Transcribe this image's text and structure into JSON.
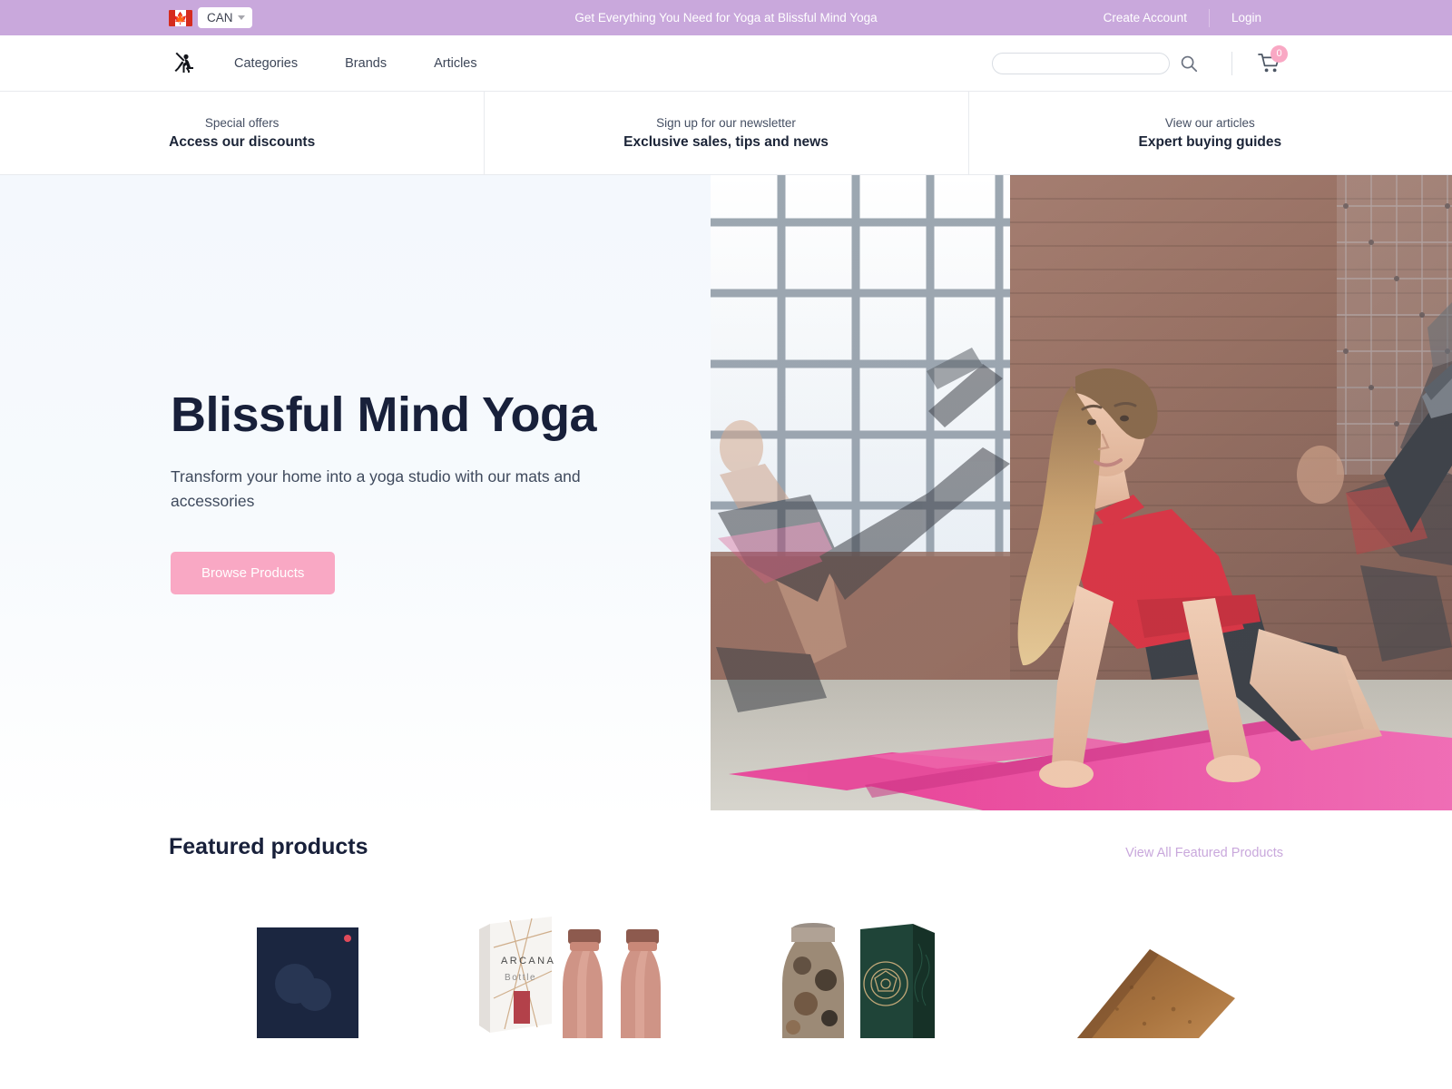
{
  "topbar": {
    "locale": {
      "country_code": "CAN",
      "flag": "canada-flag",
      "chevron": "chevron-down-icon"
    },
    "announcement": "Get Everything You Need for Yoga at Blissful Mind Yoga",
    "create_account": "Create Account",
    "login": "Login"
  },
  "header": {
    "logo_alt": "yoga-warrior-logo",
    "nav": [
      {
        "label": "Categories"
      },
      {
        "label": "Brands"
      },
      {
        "label": "Articles"
      }
    ],
    "search": {
      "value": "",
      "placeholder": ""
    },
    "search_icon": "search-icon",
    "cart": {
      "icon": "cart-icon",
      "count": "0"
    }
  },
  "promos": [
    {
      "small": "Special offers",
      "big": "Access our discounts"
    },
    {
      "small": "Sign up for our newsletter",
      "big": "Exclusive sales, tips and news"
    },
    {
      "small": "View our articles",
      "big": "Expert buying guides"
    }
  ],
  "hero": {
    "title": "Blissful Mind Yoga",
    "subtitle": "Transform your home into a yoga studio with our mats and accessories",
    "cta": "Browse Products",
    "photo_alt": "women-practicing-yoga-on-pink-mats-in-brick-studio"
  },
  "featured": {
    "title": "Featured products",
    "view_all": "View All Featured Products",
    "products": [
      {
        "alt": "navy-blue-product-box"
      },
      {
        "alt": "arcana-bottle-package-with-rose-gold-bottles",
        "label_top": "ARCANA",
        "label_bottom": "Bottle"
      },
      {
        "alt": "patterned-glass-bottle-with-dark-green-box"
      },
      {
        "alt": "cork-textured-yoga-accessory"
      }
    ]
  },
  "colors": {
    "topbar": "#c9a8dc",
    "accent_pink": "#f9a8c4",
    "text_dark": "#18203a",
    "link_purple": "#c9a8dc"
  }
}
